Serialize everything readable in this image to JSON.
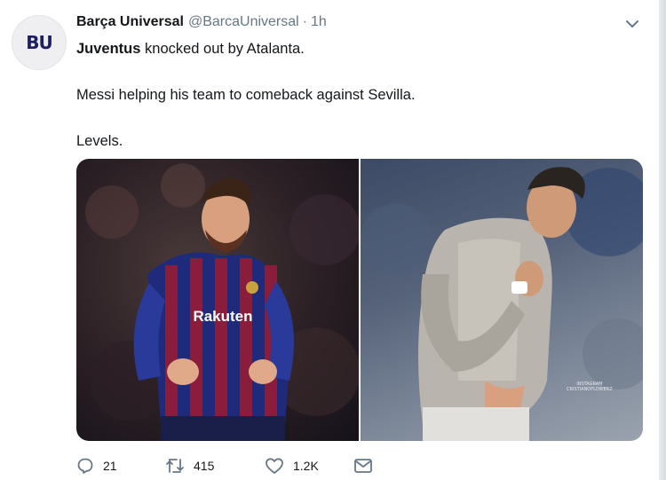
{
  "tweet": {
    "avatar_text": "BU",
    "display_name": "Barça Universal",
    "handle": "@BarcaUniversal",
    "separator": "·",
    "time": "1h",
    "lines": [
      {
        "bold": "Juventus",
        "rest": " knocked out by Atalanta."
      },
      {
        "text": "Messi helping his team to comeback against Sevilla."
      },
      {
        "text": "Levels."
      }
    ],
    "media": {
      "left_photo_text": "Rakuten",
      "right_photo_watermark_line1": "INSTAGRAM",
      "right_photo_watermark_line2": "CRISTIANOFLOWERZ"
    },
    "actions": {
      "reply_count": "21",
      "retweet_count": "415",
      "like_count": "1.2K"
    }
  },
  "icons": {
    "reply": "reply-icon",
    "retweet": "retweet-icon",
    "like": "heart-icon",
    "dm": "envelope-icon",
    "more": "chevron-down-icon"
  },
  "colors": {
    "text": "#14171a",
    "secondary": "#657786",
    "icon": "#657786",
    "avatar_text": "#1d1f5e"
  }
}
